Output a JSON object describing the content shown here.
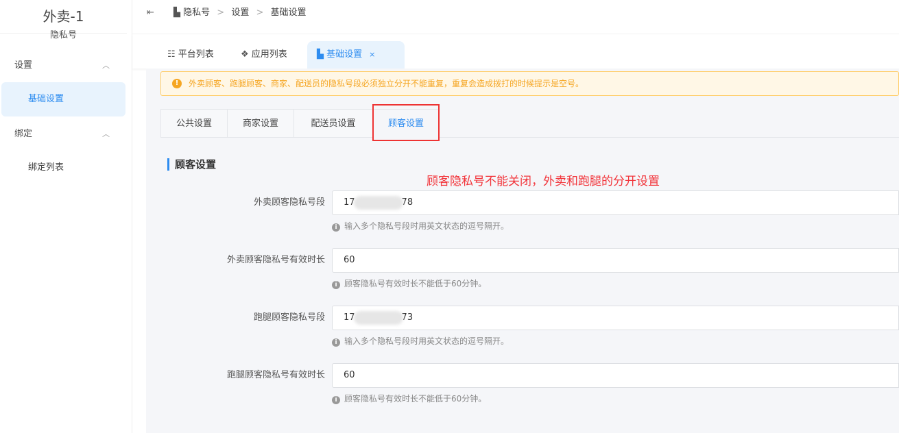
{
  "sidebar": {
    "title": "外卖-1",
    "subtitle": "隐私号",
    "groups": [
      {
        "label": "设置",
        "items": [
          "基础设置"
        ]
      },
      {
        "label": "绑定",
        "items": [
          "绑定列表"
        ]
      }
    ]
  },
  "breadcrumb": [
    "隐私号",
    "设置",
    "基础设置"
  ],
  "nav_tabs": [
    "平台列表",
    "应用列表",
    "基础设置"
  ],
  "alert": "外卖顾客、跑腿顾客、商家、配送员的隐私号段必须独立分开不能重复，重复会造成拨打的时候提示是空号。",
  "sub_tabs": [
    "公共设置",
    "商家设置",
    "配送员设置",
    "顾客设置"
  ],
  "section_title": "顾客设置",
  "annotation": "顾客隐私号不能关闭，外卖和跑腿的分开设置",
  "form": [
    {
      "label": "外卖顾客隐私号段",
      "prefix": "17",
      "suffix": "78",
      "help": "输入多个隐私号段时用英文状态的逗号隔开。"
    },
    {
      "label": "外卖顾客隐私号有效时长",
      "value": "60",
      "help": "顾客隐私号有效时长不能低于60分钟。"
    },
    {
      "label": "跑腿顾客隐私号段",
      "prefix": "17",
      "suffix": "73",
      "help": "输入多个隐私号段时用英文状态的逗号隔开。"
    },
    {
      "label": "跑腿顾客隐私号有效时长",
      "value": "60",
      "help": "顾客隐私号有效时长不能低于60分钟。"
    }
  ]
}
